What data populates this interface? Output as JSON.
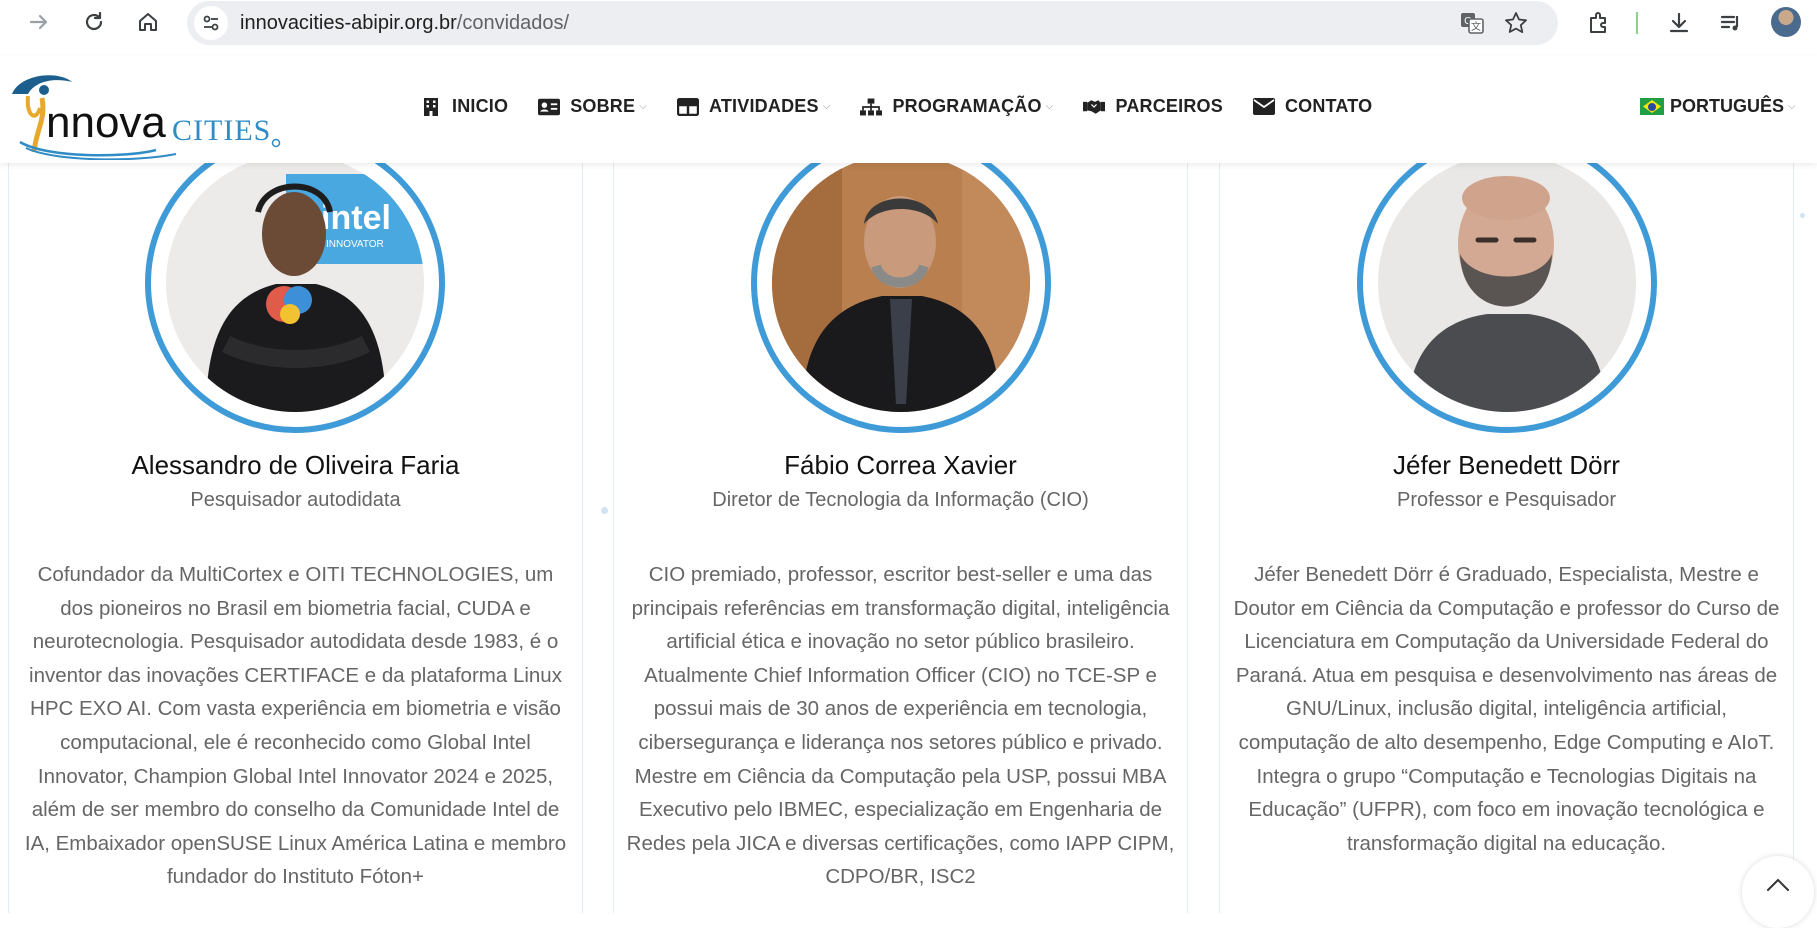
{
  "browser": {
    "url_host": "innovacities-abipir.org.br",
    "url_path": "/convidados/"
  },
  "header": {
    "logo_text": "Innova CITIES",
    "nav": [
      {
        "label": "INICIO",
        "icon": "building-icon",
        "has_caret": false
      },
      {
        "label": "SOBRE",
        "icon": "id-card-icon",
        "has_caret": true
      },
      {
        "label": "ATIVIDADES",
        "icon": "table-icon",
        "has_caret": true
      },
      {
        "label": "PROGRAMAÇÃO",
        "icon": "sitemap-icon",
        "has_caret": true
      },
      {
        "label": "PARCEIROS",
        "icon": "handshake-icon",
        "has_caret": false
      },
      {
        "label": "CONTATO",
        "icon": "envelope-icon",
        "has_caret": false
      }
    ],
    "language": "PORTUGUÊS"
  },
  "guests": [
    {
      "name": "Alessandro de Oliveira Faria",
      "role": "Pesquisador autodidata",
      "bio": "Cofundador da MultiCortex e OITI TECHNOLOGIES, um dos pioneiros no Brasil em biometria facial, CUDA e neurotecnologia. Pesquisador autodidata desde 1983, é o inventor das inovações CERTIFACE e da plataforma Linux HPC EXO AI. Com vasta experiência em biometria e visão computacional, ele é reconhecido como Global Intel Innovator, Champion Global Intel Innovator 2024 e 2025, além de ser membro do conselho da Comunidade Intel de IA, Embaixador openSUSE Linux América Latina e membro fundador do Instituto Fóton+",
      "photo_caption": "intel INNOVATOR"
    },
    {
      "name": "Fábio Correa Xavier",
      "role": "Diretor de Tecnologia da Informação (CIO)",
      "bio": "CIO premiado, professor, escritor best-seller e uma das principais referências em transformação digital, inteligência artificial ética e inovação no setor público brasileiro. Atualmente Chief Information Officer (CIO) no TCE-SP e possui mais de 30 anos de experiência em tecnologia, cibersegurança e liderança nos setores público e privado. Mestre em Ciência da Computação pela USP, possui MBA Executivo pelo IBMEC, especialização em Engenharia de Redes pela JICA e diversas certificações, como IAPP CIPM, CDPO/BR, ISC2",
      "photo_caption": ""
    },
    {
      "name": "Jéfer Benedett Dörr",
      "role": "Professor e Pesquisador",
      "bio": "Jéfer Benedett Dörr é Graduado, Especialista, Mestre e Doutor em Ciência da Computação e professor do Curso de Licenciatura em Computação da Universidade Federal do Paraná. Atua em pesquisa e desenvolvimento nas áreas de GNU/Linux, inclusão digital, inteligência artificial, computação de alto desempenho, Edge Computing e AIoT. Integra o grupo “Computação e Tecnologias Digitais na Educação” (UFPR), com foco em inovação tecnológica e transformação digital na educação.",
      "photo_caption": ""
    }
  ],
  "colors": {
    "accent": "#3f9ad8",
    "text_muted": "#666666",
    "name": "#111111"
  }
}
